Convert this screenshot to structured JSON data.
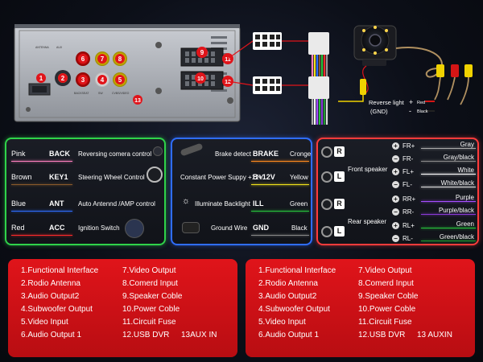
{
  "head_unit": {
    "port_numbers": [
      "1",
      "2",
      "3",
      "4",
      "5",
      "6",
      "7",
      "8",
      "9",
      "10",
      "11",
      "12",
      "13"
    ],
    "small_labels": {
      "l1": "ANTENNA",
      "l2": "AUX",
      "l3": "BACKSEAT",
      "l4": "SW",
      "l5": "CVBS/VIDEO"
    }
  },
  "camera": {
    "reverse_label": "Reverse light",
    "gnd_label": "(GND)",
    "plus_sign": "+",
    "minus_sign": "-",
    "red_text": "Red",
    "black_text": "Black"
  },
  "left_panel": {
    "rows": [
      {
        "color_name": "Pink",
        "signal": "BACK",
        "line_color": "#ff7fbf",
        "desc": "Reversing comera control"
      },
      {
        "color_name": "Brown",
        "signal": "KEY1",
        "line_color": "#8a5a2b",
        "desc": "Steering Wheel Control"
      },
      {
        "color_name": "Blue",
        "signal": "ANT",
        "line_color": "#2f6dff",
        "desc": "Auto Antennd /AMP control"
      },
      {
        "color_name": "Red",
        "signal": "ACC",
        "line_color": "#ff2a2a",
        "desc": "Ignition Switch"
      }
    ]
  },
  "mid_panel": {
    "rows": [
      {
        "desc": "Brake detect",
        "signal": "BRAKE",
        "color_name": "Cronge",
        "line_color": "#ff8a1e"
      },
      {
        "desc": "Constant Power Suppy +12V",
        "signal": "B+12V",
        "color_name": "Yellow",
        "line_color": "#f2e21a"
      },
      {
        "desc": "Illuminate Backlight",
        "signal": "ILL",
        "color_name": "Green",
        "line_color": "#27c43c"
      },
      {
        "desc": "Ground Wire",
        "signal": "GND",
        "color_name": "Black",
        "line_color": "#888888"
      }
    ]
  },
  "right_panel": {
    "front_label": "Front speaker",
    "rear_label": "Rear speaker",
    "speaker_badges": [
      "R",
      "L",
      "R",
      "L"
    ],
    "wires": [
      {
        "sign": "+",
        "code": "FR+",
        "color_name": "Gray",
        "line_color": "#aaaaaa"
      },
      {
        "sign": "−",
        "code": "FR-",
        "color_name": "Gray/black",
        "line_color": "#8a8a8a"
      },
      {
        "sign": "+",
        "code": "FL+",
        "color_name": "White",
        "line_color": "#ffffff"
      },
      {
        "sign": "−",
        "code": "FL-",
        "color_name": "White/black",
        "line_color": "#dcdcdc"
      },
      {
        "sign": "+",
        "code": "RR+",
        "color_name": "Purple",
        "line_color": "#a64dff"
      },
      {
        "sign": "−",
        "code": "RR-",
        "color_name": "Purple/black",
        "line_color": "#8a3ad6"
      },
      {
        "sign": "+",
        "code": "RL+",
        "color_name": "Green",
        "line_color": "#27c43c"
      },
      {
        "sign": "−",
        "code": "RL-",
        "color_name": "Green/black",
        "line_color": "#1f9a30"
      }
    ]
  },
  "legend_left": {
    "col1": [
      "1.Functional Interface",
      "2.Rodio Antenna",
      "3.Audio Output2",
      "4.Subwoofer Output",
      "5.Video Input",
      "6.Audio Output 1"
    ],
    "col2": [
      "7.Video Output",
      "8.Comerd Input",
      "9.Speaker Coble",
      "10.Power Coble",
      "11.Circuit Fuse",
      "12.USB DVR"
    ],
    "extra": "13AUX IN"
  },
  "legend_right": {
    "col1": [
      "1.Functional Interface",
      "2.Rodio Antenna",
      "3.Audio Output2",
      "4.Subwoofer Output",
      "5.Video Input",
      "6.Audio Output 1"
    ],
    "col2": [
      "7.Video Output",
      "8.Comerd Input",
      "9.Speaker Coble",
      "10.Power Coble",
      "11.Circuit Fuse",
      "12.USB DVR"
    ],
    "extra": "13 AUXIN"
  }
}
